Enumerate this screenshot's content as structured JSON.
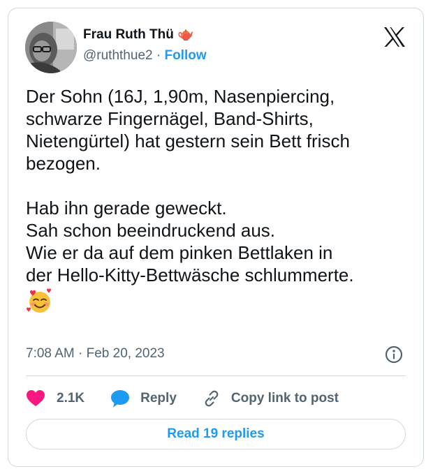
{
  "author": {
    "name": "Frau Ruth Thü 🫖",
    "handle": "@ruththue2",
    "separator": "·",
    "follow_label": "Follow"
  },
  "tweet": {
    "lines_1": [
      "Der Sohn (16J, 1,90m, Nasenpiercing,",
      "schwarze Fingernägel, Band-Shirts,",
      "Nietengürtel) hat gestern sein Bett frisch",
      "bezogen."
    ],
    "lines_2": [
      "Hab ihn gerade geweckt.",
      "Sah schon beeindruckend aus.",
      "Wie er da auf dem pinken Bettlaken in",
      "der Hello-Kitty-Bettwäsche schlummerte."
    ],
    "emoji": "smiling-face-with-hearts"
  },
  "meta": {
    "time": "7:08 AM",
    "separator": "·",
    "date": "Feb 20, 2023"
  },
  "actions": {
    "like_count": "2.1K",
    "reply_label": "Reply",
    "copy_label": "Copy link to post"
  },
  "read_replies_label": "Read 19 replies",
  "colors": {
    "accent": "#1d9bf0",
    "like": "#f91880",
    "text": "#0f1419",
    "secondary": "#536471",
    "border": "#cfd9de"
  }
}
